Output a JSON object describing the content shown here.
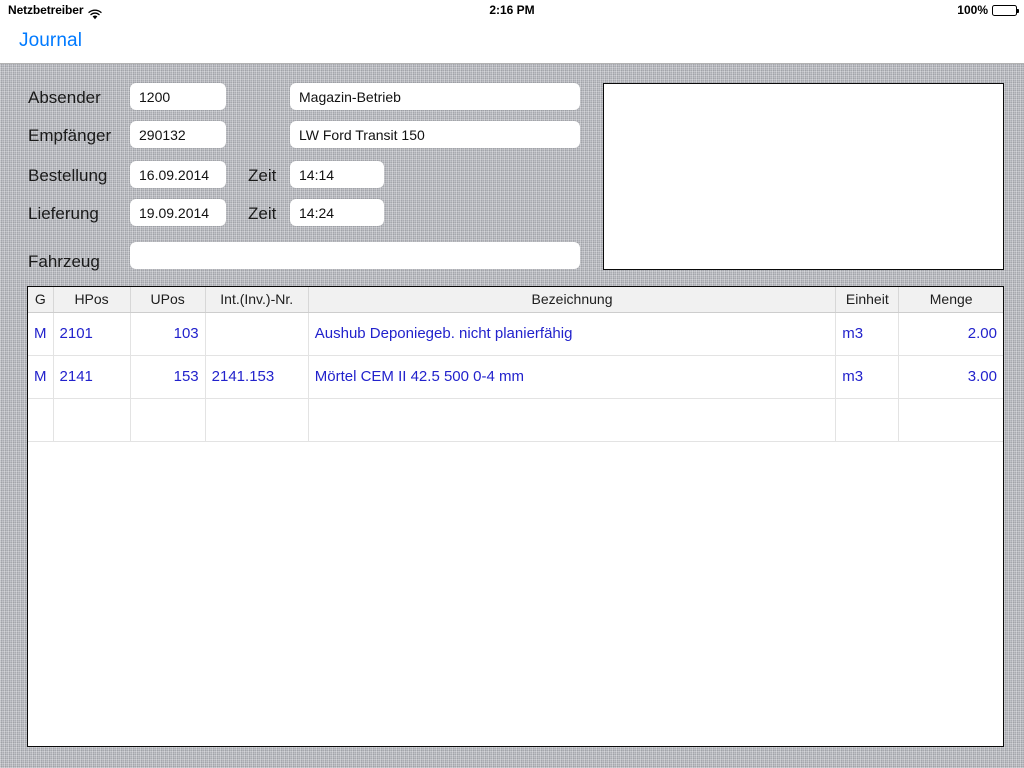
{
  "statusbar": {
    "carrier": "Netzbetreiber",
    "wifi_icon": "wifi-icon",
    "time": "2:16 PM",
    "battery_percent": "100%",
    "battery_icon": "battery-full-icon"
  },
  "navbar": {
    "title": "Journal"
  },
  "form": {
    "rows": [
      {
        "label": "Absender",
        "code_value": "1200",
        "name_value": "Magazin-Betrieb"
      },
      {
        "label": "Empfänger",
        "code_value": "290132",
        "name_value": "LW Ford Transit 150"
      },
      {
        "label": "Bestellung",
        "date_value": "16.09.2014",
        "time_label": "Zeit",
        "time_value": "14:14"
      },
      {
        "label": "Lieferung",
        "date_value": "19.09.2014",
        "time_label": "Zeit",
        "time_value": "14:24"
      },
      {
        "label": "Fahrzeug",
        "value": ""
      }
    ]
  },
  "signature_panel": {
    "content": ""
  },
  "table": {
    "columns": [
      "G",
      "HPos",
      "UPos",
      "Int.(Inv.)-Nr.",
      "Bezeichnung",
      "Einheit",
      "Menge"
    ],
    "rows": [
      {
        "g": "M",
        "hpos": "2101",
        "upos": "103",
        "inv": "",
        "bezeichnung": "Aushub Deponiegeb. nicht planierfähig",
        "einheit": "m3",
        "menge": "2.00"
      },
      {
        "g": "M",
        "hpos": "2141",
        "upos": "153",
        "inv": "2141.153",
        "bezeichnung": "Mörtel CEM II 42.5 500 0-4 mm",
        "einheit": "m3",
        "menge": "3.00"
      },
      {
        "g": "",
        "hpos": "",
        "upos": "",
        "inv": "",
        "bezeichnung": "",
        "einheit": "",
        "menge": ""
      }
    ]
  },
  "colors": {
    "accent": "#007aff",
    "data_text": "#2222cc",
    "background": "#b3b5bb",
    "header_bg": "#f1f1f1"
  }
}
